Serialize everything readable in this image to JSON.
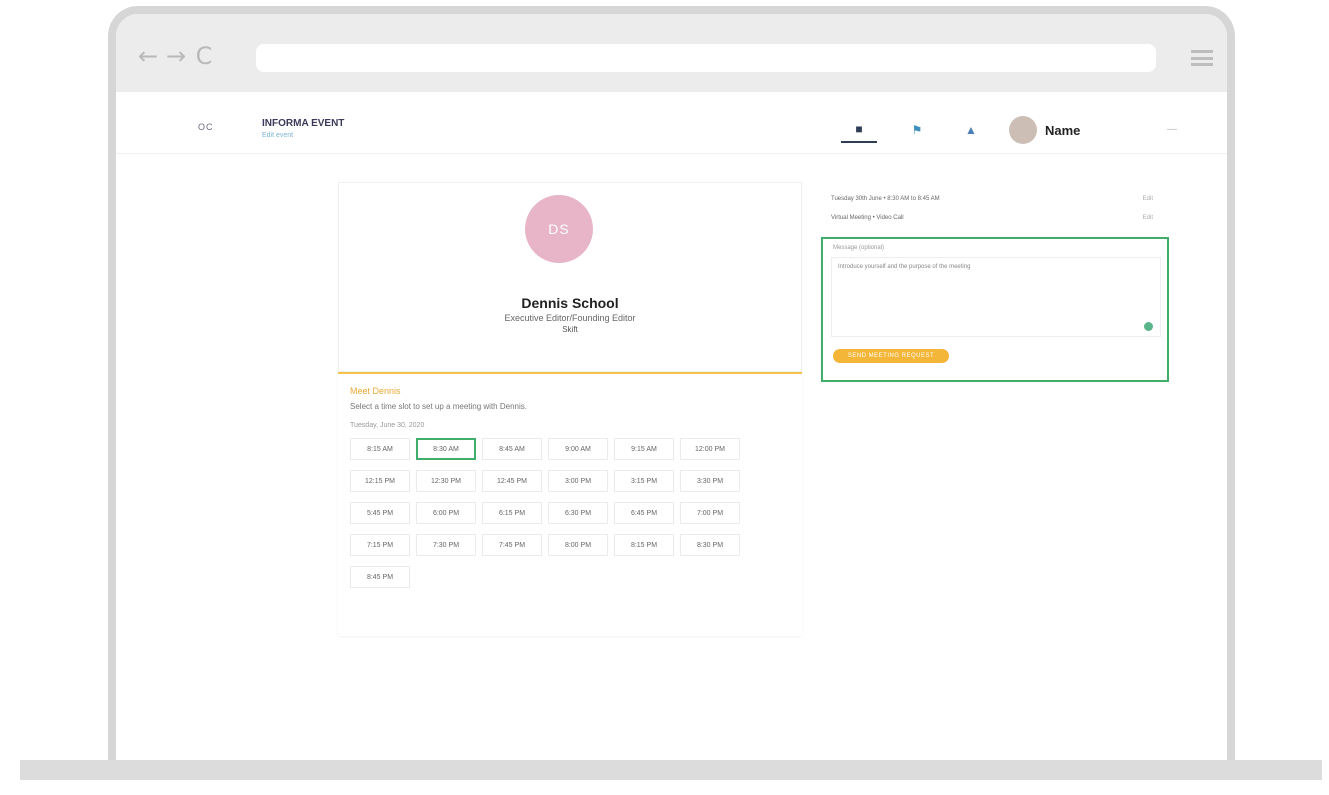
{
  "browser": {
    "back_glyph": "←",
    "forward_glyph": "→",
    "reload_glyph": "C",
    "url": ""
  },
  "header": {
    "logo": "OC",
    "event_title": "INFORMA EVENT",
    "event_subtitle": "Edit event",
    "user_name": "Name",
    "more": "—"
  },
  "profile": {
    "initials": "DS",
    "name": "Dennis School",
    "title": "Executive Editor/Founding Editor",
    "company": "Skift",
    "avatar_color": "#e8b5c8"
  },
  "meet": {
    "heading": "Meet Dennis",
    "description": "Select a time slot to set up a meeting with Dennis.",
    "date": "Tuesday, June 30, 2020",
    "slots": [
      "8:15 AM",
      "8:30 AM",
      "8:45 AM",
      "9:00 AM",
      "9:15 AM",
      "12:00 PM",
      "12:15 PM",
      "12:30 PM",
      "12:45 PM",
      "3:00 PM",
      "3:15 PM",
      "3:30 PM",
      "5:45 PM",
      "6:00 PM",
      "6:15 PM",
      "6:30 PM",
      "6:45 PM",
      "7:00 PM",
      "7:15 PM",
      "7:30 PM",
      "7:45 PM",
      "8:00 PM",
      "8:15 PM",
      "8:30 PM",
      "8:45 PM"
    ],
    "selected_slot": "8:30 AM",
    "accent": "#f3c34c"
  },
  "meeting": {
    "time_row": "Tuesday 30th June • 8:30 AM to 8:45 AM",
    "type_row": "Virtual Meeting • Video Call",
    "edit_label": "Edit",
    "message_label": "Message (optional)",
    "message_placeholder": "Introduce yourself and the purpose of the meeting",
    "send_label": "SEND MEETING REQUEST",
    "highlight_color": "#3fae6a"
  }
}
